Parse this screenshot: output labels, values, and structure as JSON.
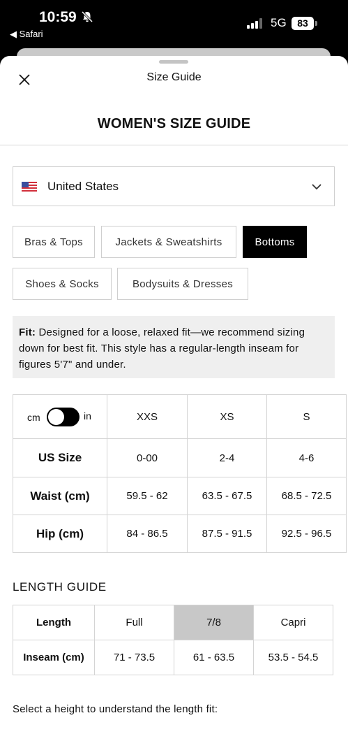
{
  "status_bar": {
    "time": "10:59",
    "back_app": "◀ Safari",
    "network": "5G",
    "battery": "83"
  },
  "sheet": {
    "title": "Size Guide"
  },
  "guide_title": "WOMEN'S SIZE GUIDE",
  "country_select": {
    "selected": "United States"
  },
  "categories": [
    {
      "label": "Bras & Tops",
      "active": false
    },
    {
      "label": "Jackets & Sweatshirts",
      "active": false
    },
    {
      "label": "Bottoms",
      "active": true
    },
    {
      "label": "Shoes & Socks",
      "active": false
    },
    {
      "label": "Bodysuits & Dresses",
      "active": false
    }
  ],
  "fit": {
    "label": "Fit:",
    "text": "Designed for a loose, relaxed fit—we recommend sizing down for best fit. This style has a regular-length inseam for figures 5'7\" and under."
  },
  "size_table": {
    "unit_toggle": {
      "left": "cm",
      "right": "in",
      "selected": "cm"
    },
    "columns": [
      "XXS",
      "XS",
      "S"
    ],
    "rows": [
      {
        "label": "US Size",
        "values": [
          "0-00",
          "2-4",
          "4-6"
        ]
      },
      {
        "label": "Waist (cm)",
        "values": [
          "59.5 - 62",
          "63.5 - 67.5",
          "68.5 - 72.5"
        ]
      },
      {
        "label": "Hip (cm)",
        "values": [
          "84 - 86.5",
          "87.5 - 91.5",
          "92.5 - 96.5"
        ]
      }
    ]
  },
  "length_guide": {
    "heading": "LENGTH GUIDE",
    "header_label": "Length",
    "columns": [
      "Full",
      "7/8",
      "Capri"
    ],
    "selected_column": "7/8",
    "row_label": "Inseam (cm)",
    "values": [
      "71 - 73.5",
      "61 - 63.5",
      "53.5 - 54.5"
    ]
  },
  "height_prompt": "Select a height to understand the length fit:"
}
